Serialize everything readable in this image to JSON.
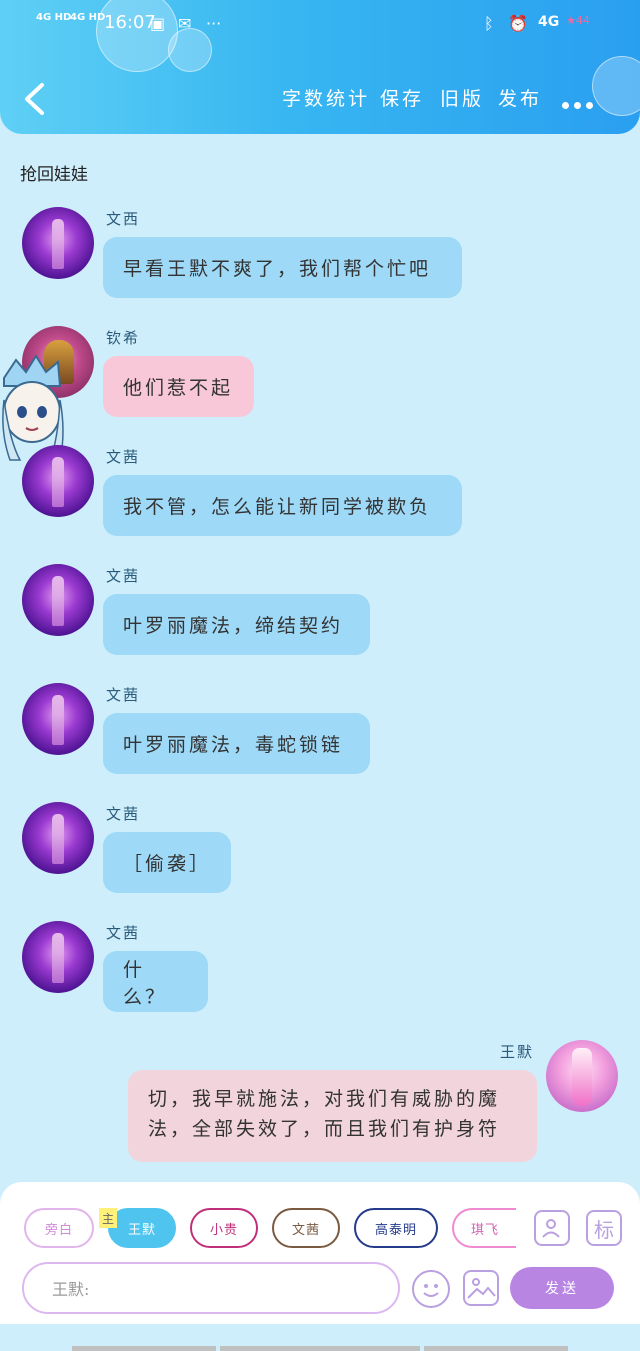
{
  "status_bar": {
    "signal1": "4G HD",
    "signal2": "4G HD",
    "time": "16:07",
    "right_network": "4G",
    "battery": "44"
  },
  "header": {
    "nav": [
      "字数统计",
      "保存",
      "旧版",
      "发布"
    ]
  },
  "chapter_title": "抢回娃娃",
  "messages": [
    {
      "name": "文西",
      "text": "早看王默不爽了，我们帮个忙吧",
      "avatar": "purple-girl"
    },
    {
      "name": "钦希",
      "text": "他们惹不起",
      "avatar": "warrior"
    },
    {
      "name": "文茜",
      "text": "我不管，怎么能让新同学被欺负",
      "avatar": "purple-girl"
    },
    {
      "name": "文茜",
      "text": "叶罗丽魔法，缔结契约",
      "avatar": "purple-girl"
    },
    {
      "name": "文茜",
      "text": "叶罗丽魔法，毒蛇锁链",
      "avatar": "purple-girl"
    },
    {
      "name": "文茜",
      "text": "［偷袭］",
      "avatar": "purple-girl"
    },
    {
      "name": "文茜",
      "text": "什么？",
      "avatar": "purple-girl"
    }
  ],
  "right_message": {
    "name": "王默",
    "line1": "切，我早就施法，对我们有威胁的魔",
    "line2": "法，全部失效了，而且我们有护身符"
  },
  "composer": {
    "tag_main": "主",
    "chips": [
      "旁白",
      "王默",
      "小贵",
      "文茜",
      "高泰明",
      "琪飞"
    ],
    "active_chip": "王默",
    "input_placeholder": "王默:",
    "send_label": "发送",
    "mark_label": "标"
  },
  "colors": {
    "accent": "#37b6f1",
    "bubble_blue": "#9ed9f7",
    "bubble_pink": "#f8c8d8",
    "send": "#b985e3"
  }
}
